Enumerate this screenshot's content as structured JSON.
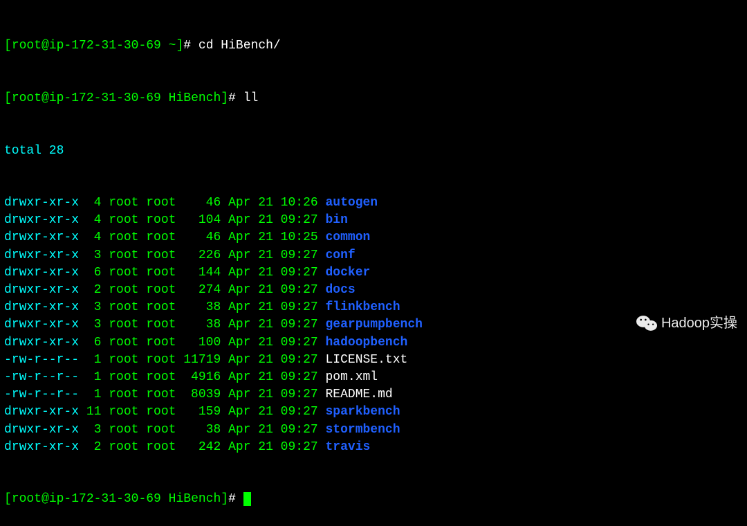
{
  "prompt1": {
    "user_host": "root@ip-172-31-30-69",
    "dir": "~",
    "command": "cd HiBench/"
  },
  "prompt2": {
    "user_host": "root@ip-172-31-30-69",
    "dir": "HiBench",
    "command": "ll"
  },
  "total": "total 28",
  "rows": [
    {
      "perm": "drwxr-xr-x",
      "links": " 4",
      "owner": "root",
      "group": "root",
      "size": "   46",
      "date": "Apr 21 10:26",
      "name": "autogen",
      "blue": true
    },
    {
      "perm": "drwxr-xr-x",
      "links": " 4",
      "owner": "root",
      "group": "root",
      "size": "  104",
      "date": "Apr 21 09:27",
      "name": "bin",
      "blue": true
    },
    {
      "perm": "drwxr-xr-x",
      "links": " 4",
      "owner": "root",
      "group": "root",
      "size": "   46",
      "date": "Apr 21 10:25",
      "name": "common",
      "blue": true
    },
    {
      "perm": "drwxr-xr-x",
      "links": " 3",
      "owner": "root",
      "group": "root",
      "size": "  226",
      "date": "Apr 21 09:27",
      "name": "conf",
      "blue": true
    },
    {
      "perm": "drwxr-xr-x",
      "links": " 6",
      "owner": "root",
      "group": "root",
      "size": "  144",
      "date": "Apr 21 09:27",
      "name": "docker",
      "blue": true
    },
    {
      "perm": "drwxr-xr-x",
      "links": " 2",
      "owner": "root",
      "group": "root",
      "size": "  274",
      "date": "Apr 21 09:27",
      "name": "docs",
      "blue": true
    },
    {
      "perm": "drwxr-xr-x",
      "links": " 3",
      "owner": "root",
      "group": "root",
      "size": "   38",
      "date": "Apr 21 09:27",
      "name": "flinkbench",
      "blue": true
    },
    {
      "perm": "drwxr-xr-x",
      "links": " 3",
      "owner": "root",
      "group": "root",
      "size": "   38",
      "date": "Apr 21 09:27",
      "name": "gearpumpbench",
      "blue": true
    },
    {
      "perm": "drwxr-xr-x",
      "links": " 6",
      "owner": "root",
      "group": "root",
      "size": "  100",
      "date": "Apr 21 09:27",
      "name": "hadoopbench",
      "blue": true
    },
    {
      "perm": "-rw-r--r--",
      "links": " 1",
      "owner": "root",
      "group": "root",
      "size": "11719",
      "date": "Apr 21 09:27",
      "name": "LICENSE.txt",
      "blue": false
    },
    {
      "perm": "-rw-r--r--",
      "links": " 1",
      "owner": "root",
      "group": "root",
      "size": " 4916",
      "date": "Apr 21 09:27",
      "name": "pom.xml",
      "blue": false
    },
    {
      "perm": "-rw-r--r--",
      "links": " 1",
      "owner": "root",
      "group": "root",
      "size": " 8039",
      "date": "Apr 21 09:27",
      "name": "README.md",
      "blue": false
    },
    {
      "perm": "drwxr-xr-x",
      "links": "11",
      "owner": "root",
      "group": "root",
      "size": "  159",
      "date": "Apr 21 09:27",
      "name": "sparkbench",
      "blue": true
    },
    {
      "perm": "drwxr-xr-x",
      "links": " 3",
      "owner": "root",
      "group": "root",
      "size": "   38",
      "date": "Apr 21 09:27",
      "name": "stormbench",
      "blue": true
    },
    {
      "perm": "drwxr-xr-x",
      "links": " 2",
      "owner": "root",
      "group": "root",
      "size": "  242",
      "date": "Apr 21 09:27",
      "name": "travis",
      "blue": true
    }
  ],
  "prompt3": {
    "user_host": "root@ip-172-31-30-69",
    "dir": "HiBench"
  },
  "watermark": "Hadoop实操"
}
